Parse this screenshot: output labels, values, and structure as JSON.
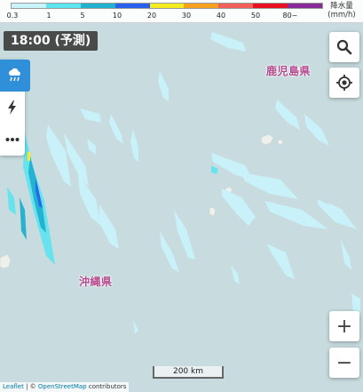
{
  "legend": {
    "ticks": [
      "0.3",
      "1",
      "5",
      "10",
      "20",
      "30",
      "40",
      "50",
      "80~"
    ],
    "unit_line1": "降水量",
    "unit_line2": "(mm/h)",
    "colors": [
      "#c9f3fb",
      "#5ee4f0",
      "#20b0d0",
      "#2660ec",
      "#f4ec20",
      "#f6a020",
      "#f06058",
      "#e81020",
      "#882a98"
    ]
  },
  "time_badge": "18:00 (予測)",
  "side_panel": {
    "rain_icon": "rain-cloud-icon",
    "lightning_icon": "lightning-icon",
    "more_icon": "more-dots-icon"
  },
  "controls": {
    "search_icon": "search-icon",
    "locate_icon": "locate-icon",
    "zoom_in": "+",
    "zoom_out": "−"
  },
  "places": {
    "kagoshima": "鹿児島県",
    "okinawa": "沖縄県"
  },
  "scale": "200 km",
  "attribution": {
    "leaflet": "Leaflet",
    "separator": " | © ",
    "osm": "OpenStreetMap",
    "contributors": " contributors"
  },
  "colors": {
    "sea": "#c8dcdf",
    "land": "#eef0ec",
    "rain_light": "#c9f3fb",
    "rain_mid": "#5ee4f0",
    "rain_heavy": "#20b0d0",
    "rain_strong": "#2660ec",
    "accent": "#2f8fd8",
    "place_label": "#b44a8e"
  }
}
